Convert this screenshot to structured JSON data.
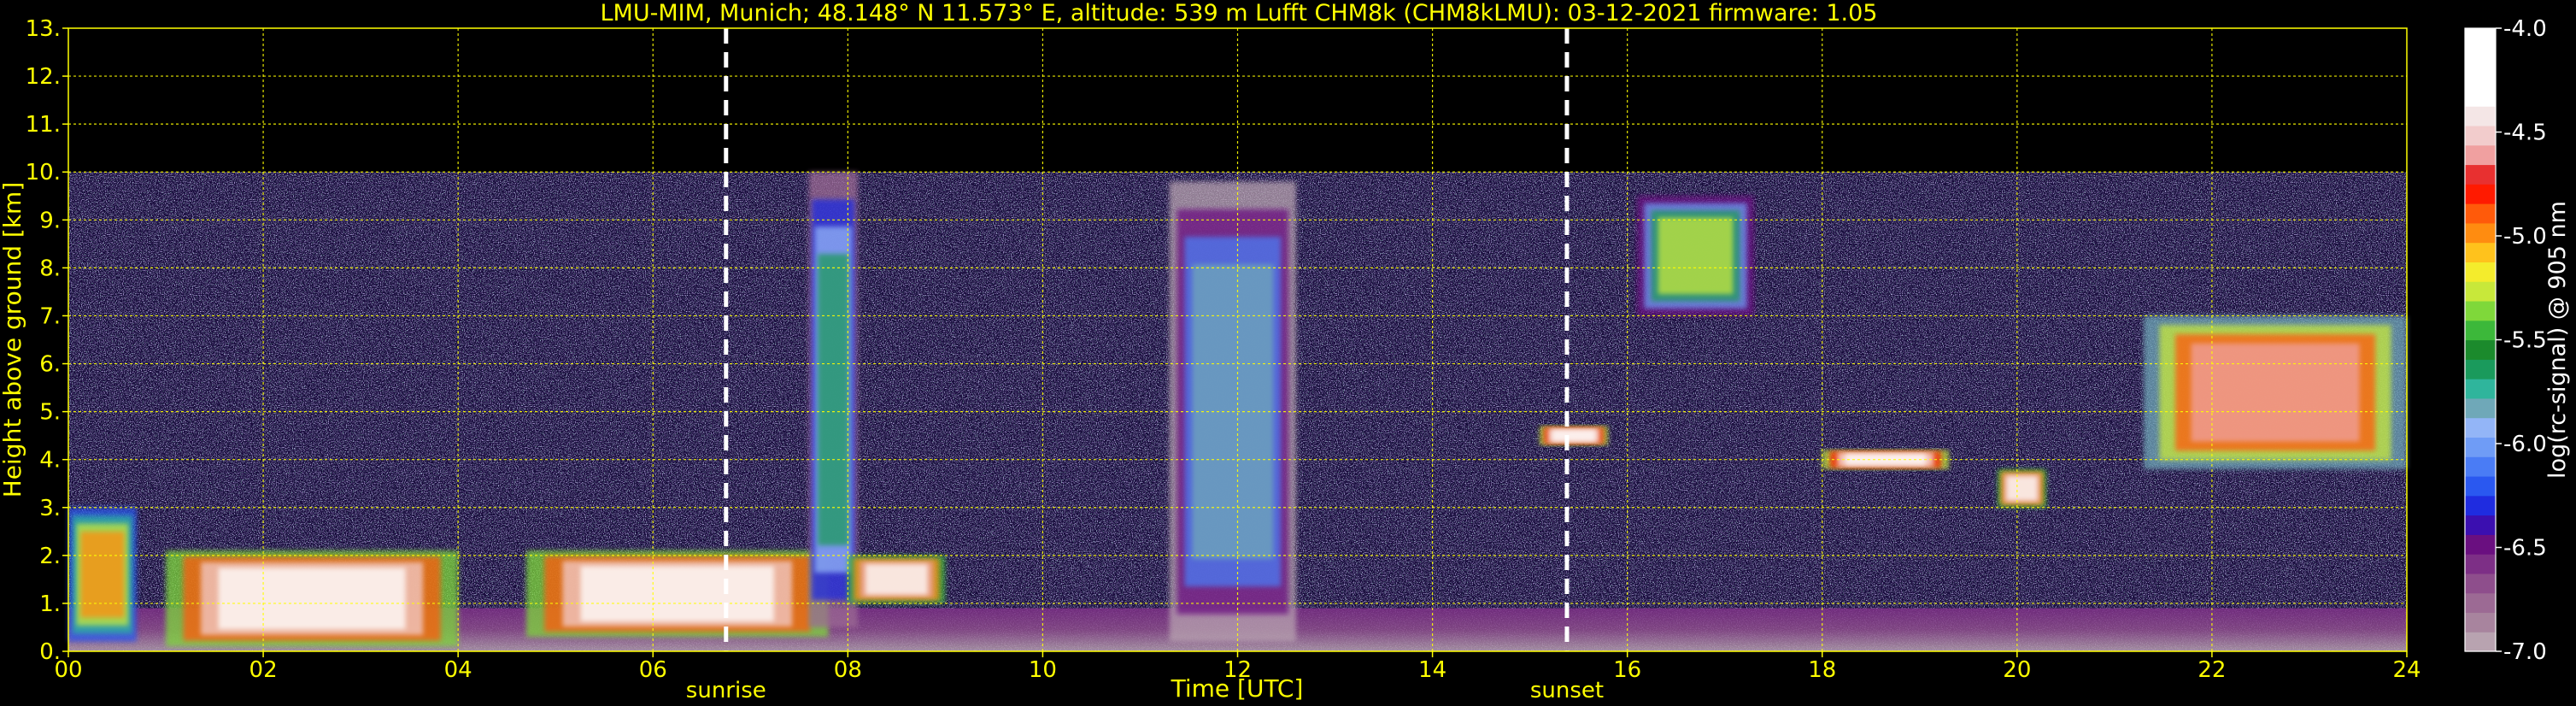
{
  "chart_data": {
    "type": "heatmap",
    "title": "LMU-MIM, Munich; 48.148° N 11.573° E, altitude: 539 m    Lufft CHM8k (CHM8kLMU): 03-12-2021    firmware: 1.05",
    "xlabel": "Time [UTC]",
    "ylabel": "Height above ground [km]",
    "xlim": [
      0,
      24
    ],
    "ylim": [
      0,
      13
    ],
    "x_ticks": [
      "00",
      "02",
      "04",
      "06",
      "08",
      "10",
      "12",
      "14",
      "16",
      "18",
      "20",
      "22",
      "24"
    ],
    "y_ticks": [
      "0.",
      "1.",
      "2.",
      "3.",
      "4.",
      "5.",
      "6.",
      "7.",
      "8.",
      "9.",
      "10.",
      "11.",
      "12.",
      "13."
    ],
    "grid": true,
    "data_top_km": 10,
    "events": [
      {
        "label": "sunrise",
        "time": 6.75
      },
      {
        "label": "sunset",
        "time": 15.38
      }
    ],
    "colorbar": {
      "label": "log(rc-signal) @ 905 nm",
      "range": [
        -7.0,
        -4.0
      ],
      "ticks": [
        "-4.0",
        "-4.5",
        "-5.0",
        "-5.5",
        "-6.0",
        "-6.5",
        "-7.0"
      ],
      "colors": [
        "#b8a3b0",
        "#a8849e",
        "#9c6a94",
        "#8e4e8c",
        "#7d2f86",
        "#6a0f80",
        "#3b0fb0",
        "#1f2ce0",
        "#2a58f0",
        "#4a7cf5",
        "#6f9cf6",
        "#93b5f7",
        "#6fa8b8",
        "#2fb59c",
        "#1a9a5c",
        "#1b8a2c",
        "#3cb83a",
        "#7fd83a",
        "#c8e83a",
        "#f4ec2c",
        "#ffc21c",
        "#ff8c10",
        "#ff5a0a",
        "#ff1a00",
        "#e83030",
        "#f0a0a0",
        "#f2cccc",
        "#f4e6e6",
        "#ffffff",
        "#ffffff",
        "#ffffff",
        "#ffffff"
      ]
    },
    "cloud_features": [
      {
        "start": 0.0,
        "end": 0.7,
        "base_km": 0.2,
        "top_km": 3.0,
        "level": -5.0
      },
      {
        "start": 1.0,
        "end": 4.0,
        "base_km": 0.1,
        "top_km": 2.1,
        "level": -4.2
      },
      {
        "start": 4.7,
        "end": 7.8,
        "base_km": 0.3,
        "top_km": 2.1,
        "level": -4.2
      },
      {
        "start": 7.6,
        "end": 8.1,
        "base_km": 0.5,
        "top_km": 10.0,
        "level": -5.6
      },
      {
        "start": 8.0,
        "end": 9.0,
        "base_km": 1.0,
        "top_km": 2.0,
        "level": -4.3
      },
      {
        "start": 11.3,
        "end": 12.6,
        "base_km": 0.2,
        "top_km": 9.8,
        "level": -5.8
      },
      {
        "start": 15.1,
        "end": 15.8,
        "base_km": 4.3,
        "top_km": 4.7,
        "level": -4.1
      },
      {
        "start": 16.1,
        "end": 17.3,
        "base_km": 7.0,
        "top_km": 9.5,
        "level": -5.3
      },
      {
        "start": 18.0,
        "end": 19.3,
        "base_km": 3.8,
        "top_km": 4.2,
        "level": -4.1
      },
      {
        "start": 19.8,
        "end": 20.3,
        "base_km": 3.0,
        "top_km": 3.8,
        "level": -4.3
      },
      {
        "start": 21.3,
        "end": 24.0,
        "base_km": 3.8,
        "top_km": 7.0,
        "level": -4.6
      }
    ]
  }
}
